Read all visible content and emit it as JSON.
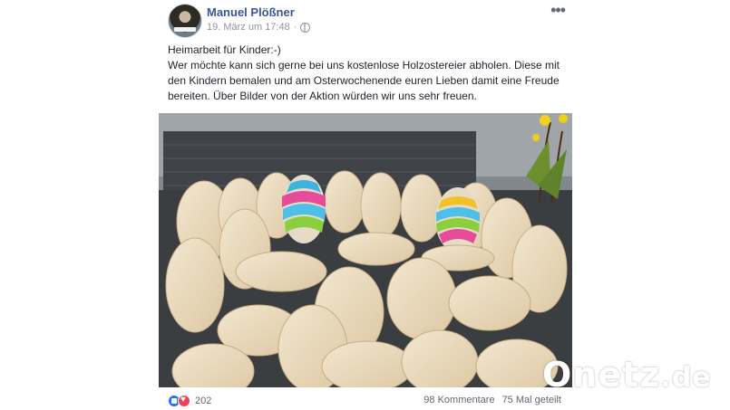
{
  "post": {
    "author": "Manuel Plößner",
    "timestamp": "19. März um 17:48",
    "privacy_icon": "globe-icon",
    "text_lines": [
      "Heimarbeit für Kinder:-)",
      "Wer möchte kann sich gerne bei uns kostenlose Holzostereier abholen. Diese mit den Kindern bemalen und am Osterwochenende euren Lieben damit eine Freude bereiten. Über Bilder von der Aktion würden wir uns sehr freuen."
    ]
  },
  "footer": {
    "reaction_icons": [
      "like-icon",
      "love-icon"
    ],
    "reaction_count": "202",
    "comments": "98 Kommentare",
    "shares": "75 Mal geteilt"
  },
  "watermark": {
    "brand": "Onetz",
    "suffix": ".de"
  },
  "colors": {
    "author": "#365899",
    "like": "#1877f2",
    "love": "#f33e58"
  }
}
